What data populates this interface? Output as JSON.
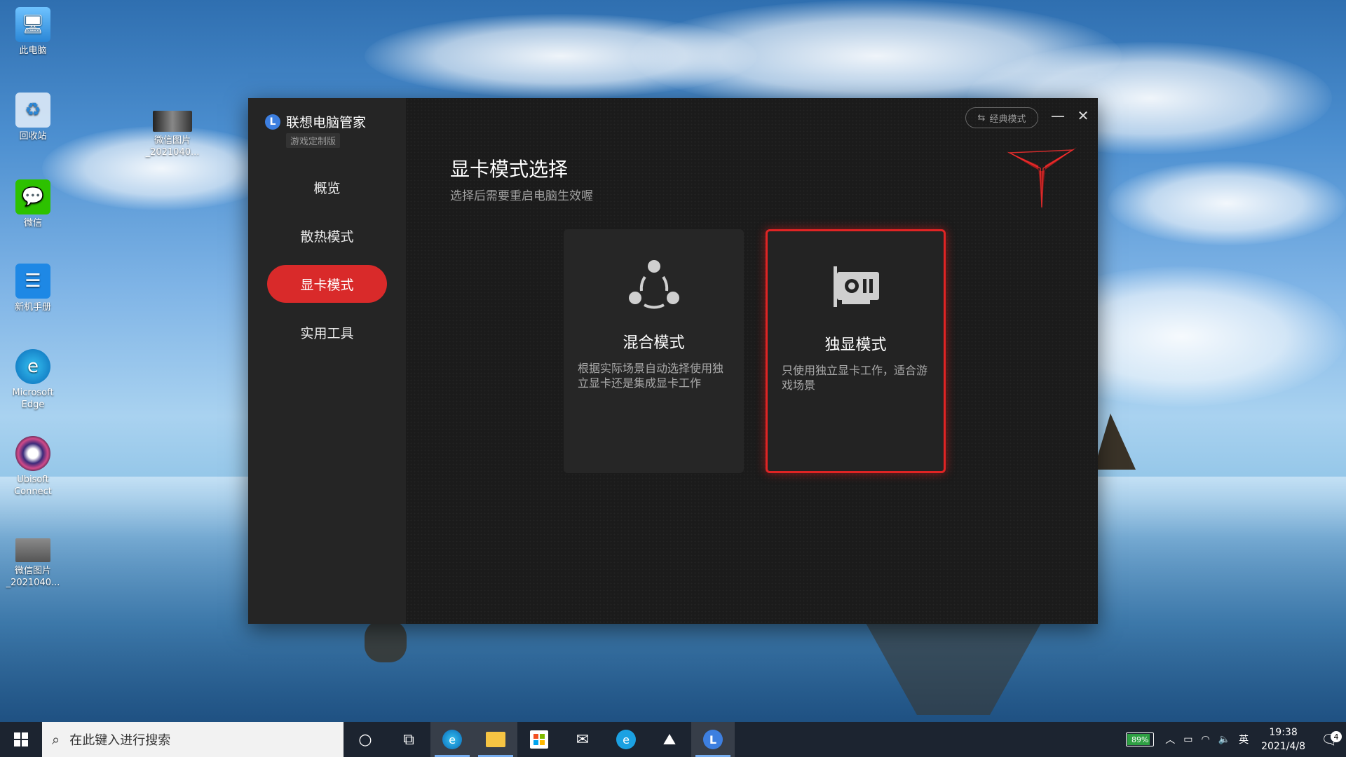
{
  "desktop": {
    "icons": [
      {
        "label": "此电脑",
        "icon": "computer-icon"
      },
      {
        "label": "回收站",
        "icon": "recycle-bin-icon"
      },
      {
        "label": "微信",
        "icon": "wechat-icon"
      },
      {
        "label": "新机手册",
        "icon": "manual-icon"
      },
      {
        "label": "Microsoft Edge",
        "icon": "edge-icon"
      },
      {
        "label": "Ubisoft Connect",
        "icon": "ubisoft-icon"
      },
      {
        "label": "微信图片_2021040...",
        "icon": "image-file-icon"
      }
    ],
    "second_column_icon": {
      "label": "微信图片_2021040...",
      "icon": "image-file-icon"
    }
  },
  "app": {
    "brand_name": "联想电脑管家",
    "brand_sub": "游戏定制版",
    "brand_logo_letter": "L",
    "nav": [
      {
        "label": "概览",
        "active": false
      },
      {
        "label": "散热模式",
        "active": false
      },
      {
        "label": "显卡模式",
        "active": true
      },
      {
        "label": "实用工具",
        "active": false
      }
    ],
    "classic_mode_label": "经典模式",
    "title": "显卡模式选择",
    "subtitle": "选择后需要重启电脑生效喔",
    "cards": [
      {
        "title": "混合模式",
        "desc": "根据实际场景自动选择使用独立显卡还是集成显卡工作",
        "icon": "hybrid-mode-icon",
        "selected": false
      },
      {
        "title": "独显模式",
        "desc": "只使用独立显卡工作，适合游戏场景",
        "icon": "gpu-card-icon",
        "selected": true
      }
    ],
    "accent_color": "#e02424"
  },
  "taskbar": {
    "search_placeholder": "在此键入进行搜索",
    "apps": [
      "cortana-icon",
      "task-view-icon",
      "edge-icon",
      "file-explorer-icon",
      "store-icon",
      "mail-icon",
      "ie-icon",
      "photos-icon",
      "lenovo-vantage-icon"
    ],
    "battery_percent": "89%",
    "battery_level": 0.89,
    "ime": "英",
    "time": "19:38",
    "date": "2021/4/8",
    "notification_count": "4"
  }
}
